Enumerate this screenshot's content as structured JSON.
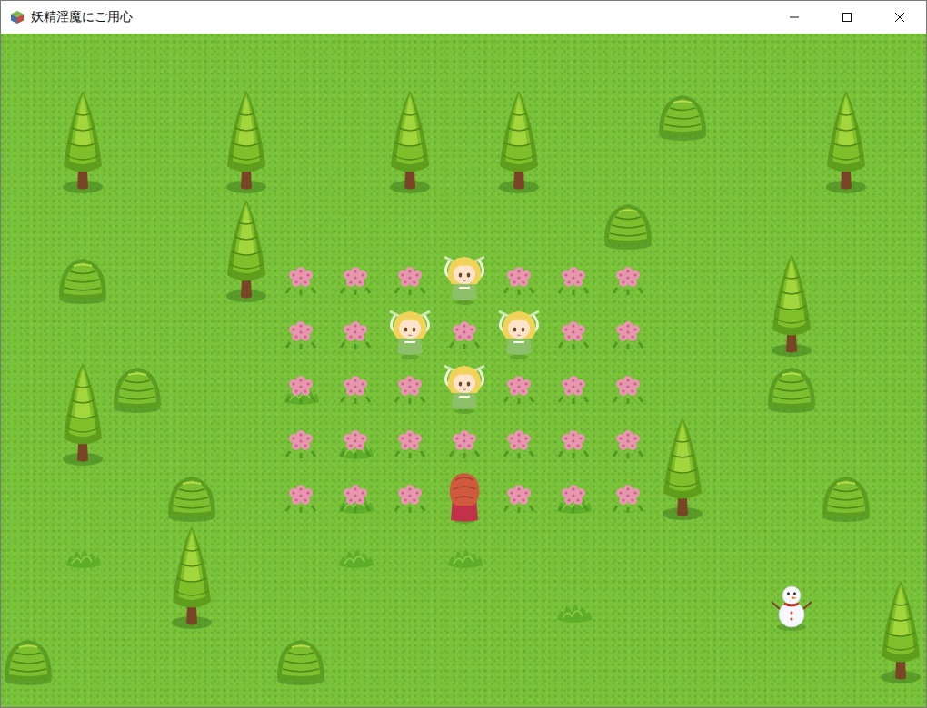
{
  "window": {
    "title": "妖精淫魔にご用心"
  },
  "map": {
    "entities": [
      {
        "kind": "grass",
        "col": 1,
        "row": 9
      },
      {
        "kind": "grass",
        "col": 6,
        "row": 9
      },
      {
        "kind": "grass",
        "col": 8,
        "row": 9
      },
      {
        "kind": "grass",
        "col": 10,
        "row": 10
      },
      {
        "kind": "grass",
        "col": 5,
        "row": 6
      },
      {
        "kind": "grass",
        "col": 6,
        "row": 7
      },
      {
        "kind": "grass",
        "col": 6,
        "row": 8
      },
      {
        "kind": "grass",
        "col": 10,
        "row": 8
      },
      {
        "kind": "flower",
        "col": 5,
        "row": 4
      },
      {
        "kind": "flower",
        "col": 6,
        "row": 4
      },
      {
        "kind": "flower",
        "col": 7,
        "row": 4
      },
      {
        "kind": "flower",
        "col": 9,
        "row": 4
      },
      {
        "kind": "flower",
        "col": 10,
        "row": 4
      },
      {
        "kind": "flower",
        "col": 11,
        "row": 4
      },
      {
        "kind": "flower",
        "col": 5,
        "row": 5
      },
      {
        "kind": "flower",
        "col": 6,
        "row": 5
      },
      {
        "kind": "flower",
        "col": 8,
        "row": 5
      },
      {
        "kind": "flower",
        "col": 10,
        "row": 5
      },
      {
        "kind": "flower",
        "col": 11,
        "row": 5
      },
      {
        "kind": "flower",
        "col": 5,
        "row": 6
      },
      {
        "kind": "flower",
        "col": 6,
        "row": 6
      },
      {
        "kind": "flower",
        "col": 7,
        "row": 6
      },
      {
        "kind": "flower",
        "col": 9,
        "row": 6
      },
      {
        "kind": "flower",
        "col": 10,
        "row": 6
      },
      {
        "kind": "flower",
        "col": 11,
        "row": 6
      },
      {
        "kind": "flower",
        "col": 5,
        "row": 7
      },
      {
        "kind": "flower",
        "col": 6,
        "row": 7
      },
      {
        "kind": "flower",
        "col": 7,
        "row": 7
      },
      {
        "kind": "flower",
        "col": 8,
        "row": 7
      },
      {
        "kind": "flower",
        "col": 9,
        "row": 7
      },
      {
        "kind": "flower",
        "col": 10,
        "row": 7
      },
      {
        "kind": "flower",
        "col": 11,
        "row": 7
      },
      {
        "kind": "flower",
        "col": 5,
        "row": 8
      },
      {
        "kind": "flower",
        "col": 6,
        "row": 8
      },
      {
        "kind": "flower",
        "col": 7,
        "row": 8
      },
      {
        "kind": "flower",
        "col": 9,
        "row": 8
      },
      {
        "kind": "flower",
        "col": 10,
        "row": 8
      },
      {
        "kind": "flower",
        "col": 11,
        "row": 8
      },
      {
        "kind": "bush",
        "col": 12,
        "row": 1
      },
      {
        "kind": "bush",
        "col": 11,
        "row": 3
      },
      {
        "kind": "bush",
        "col": 1,
        "row": 4
      },
      {
        "kind": "bush",
        "col": 2,
        "row": 6
      },
      {
        "kind": "bush",
        "col": 14,
        "row": 6
      },
      {
        "kind": "bush",
        "col": 3,
        "row": 8
      },
      {
        "kind": "bush",
        "col": 15,
        "row": 8
      },
      {
        "kind": "bush",
        "col": 0,
        "row": 11
      },
      {
        "kind": "bush",
        "col": 5,
        "row": 11
      },
      {
        "kind": "tree",
        "col": 1,
        "row": 1
      },
      {
        "kind": "tree",
        "col": 4,
        "row": 1
      },
      {
        "kind": "tree",
        "col": 7,
        "row": 1
      },
      {
        "kind": "tree",
        "col": 9,
        "row": 1
      },
      {
        "kind": "tree",
        "col": 15,
        "row": 1
      },
      {
        "kind": "tree",
        "col": 4,
        "row": 3
      },
      {
        "kind": "tree",
        "col": 14,
        "row": 4
      },
      {
        "kind": "tree",
        "col": 1,
        "row": 6
      },
      {
        "kind": "tree",
        "col": 12,
        "row": 7
      },
      {
        "kind": "tree",
        "col": 3,
        "row": 9
      },
      {
        "kind": "tree",
        "col": 16,
        "row": 10
      },
      {
        "kind": "snowman",
        "col": 14,
        "row": 10
      },
      {
        "kind": "fairy",
        "col": 8,
        "row": 4
      },
      {
        "kind": "fairy",
        "col": 7,
        "row": 5
      },
      {
        "kind": "fairy",
        "col": 9,
        "row": 5
      },
      {
        "kind": "fairy",
        "col": 8,
        "row": 6
      },
      {
        "kind": "player",
        "col": 8,
        "row": 8
      }
    ]
  }
}
